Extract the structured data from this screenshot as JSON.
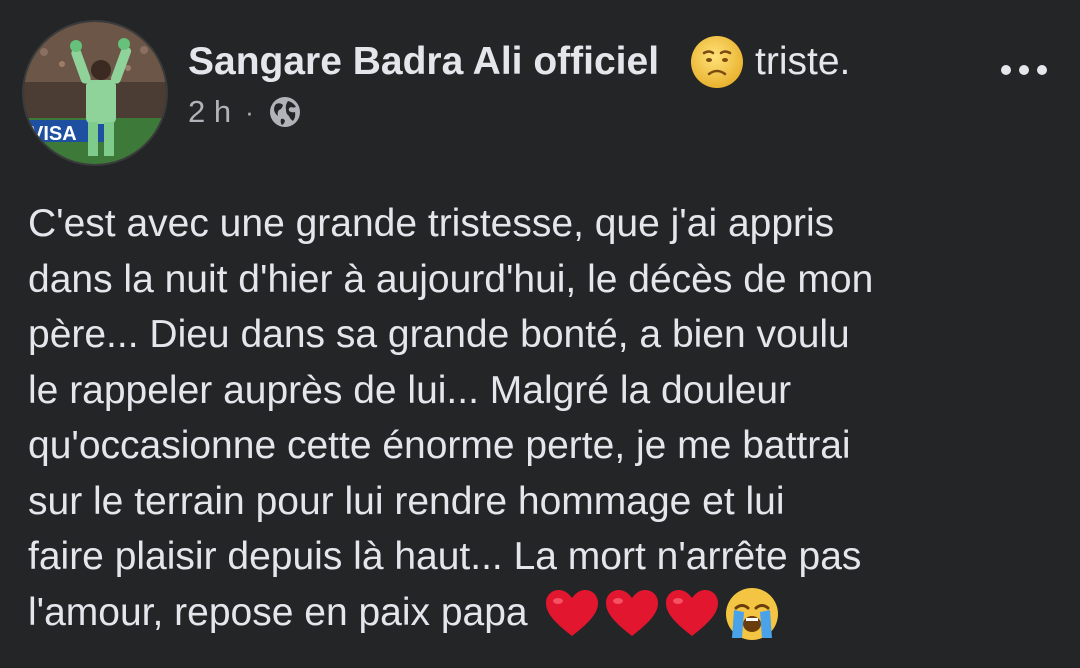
{
  "post": {
    "author": "Sangare Badra Ali officiel",
    "feeling": {
      "icon": "sad-face-emoji-icon",
      "text": "triste."
    },
    "timestamp": "2 h",
    "separator": "·",
    "audience_icon": "globe-icon",
    "more_icon": "more-options-icon",
    "body_lines": [
      "C'est avec une grande tristesse, que j'ai appris",
      "dans la nuit d'hier à aujourd'hui, le décès de mon",
      "père... Dieu dans sa grande bonté, a bien voulu",
      "le rappeler auprès de lui... Malgré la douleur",
      "qu'occasionne cette énorme perte, je me battrai",
      "sur le terrain pour lui rendre hommage et lui",
      "faire plaisir depuis là haut... La mort n'arrête pas",
      "l'amour, repose en paix papa"
    ],
    "trailing_emojis": [
      "red-heart-emoji-icon",
      "red-heart-emoji-icon",
      "red-heart-emoji-icon",
      "loudly-crying-face-emoji-icon"
    ]
  },
  "colors": {
    "background": "#242526",
    "primary_text": "#e4e6eb",
    "secondary_text": "#b0b3b8",
    "heart_red": "#e2162e",
    "emoji_yellow": "#f4c542"
  }
}
